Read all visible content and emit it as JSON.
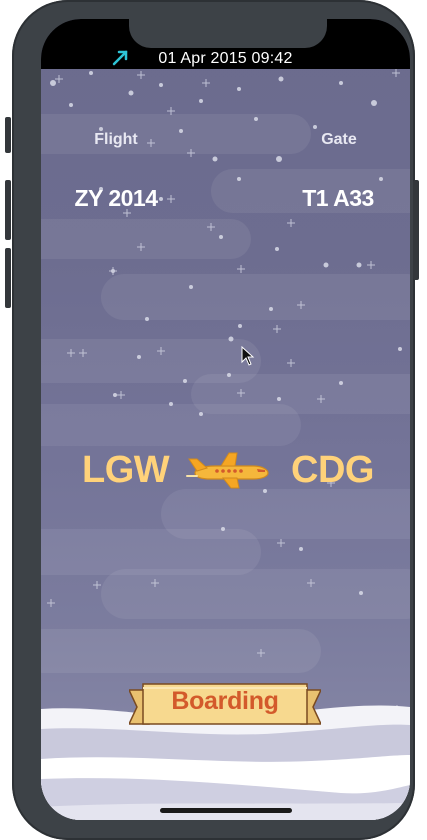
{
  "status": {
    "datetime": "01 Apr 2015 09:42"
  },
  "flight": {
    "label": "Flight",
    "number": "ZY 2014"
  },
  "gate": {
    "label": "Gate",
    "number": "T1 A33"
  },
  "route": {
    "origin": "LGW",
    "destination": "CDG"
  },
  "boarding": {
    "label": "Boarding"
  },
  "colors": {
    "sky": "#6d6d90",
    "airport_text": "#ffd27a",
    "ribbon": "#f7d98f",
    "ribbon_text": "#d35a2b",
    "status_arrow": "#2ec4d6"
  },
  "icons": {
    "status": "location-arrow-icon",
    "plane": "airplane-icon",
    "pointer": "mouse-cursor-icon"
  }
}
